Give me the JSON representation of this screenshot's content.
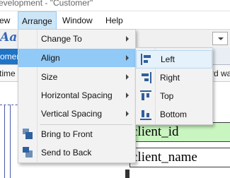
{
  "window": {
    "title": "evelopment - \"Customer\""
  },
  "menubar": {
    "items": [
      {
        "label": "ew"
      },
      {
        "label": "Arrange"
      },
      {
        "label": "Window"
      },
      {
        "label": "Help"
      }
    ]
  },
  "toolbar": {
    "font_preview": "Aa"
  },
  "tabs": {
    "active_label": "omer*"
  },
  "columns": {
    "left": "time",
    "right": "rd wa"
  },
  "canvas": {
    "fields": [
      {
        "label": "client_id",
        "color": "#c9f5c0"
      },
      {
        "label": "client_name",
        "color": "#ffffff"
      }
    ]
  },
  "arrange_menu": {
    "items": [
      {
        "label": "Change To"
      },
      {
        "label": "Align"
      },
      {
        "label": "Size"
      },
      {
        "label": "Horizontal Spacing"
      },
      {
        "label": "Vertical Spacing"
      },
      {
        "label": "Bring to Front",
        "icon": "bring-to-front-icon"
      },
      {
        "label": "Send to Back",
        "icon": "send-to-back-icon"
      }
    ]
  },
  "align_submenu": {
    "items": [
      {
        "label": "Left",
        "icon": "align-left-icon"
      },
      {
        "label": "Right",
        "icon": "align-right-icon"
      },
      {
        "label": "Top",
        "icon": "align-top-icon"
      },
      {
        "label": "Bottom",
        "icon": "align-bottom-icon"
      }
    ]
  },
  "colors": {
    "accent": "#1f74c6",
    "menu_highlight": "#91c9f7",
    "icon_blue": "#2f5f9e",
    "field_green": "#c9f5c0"
  }
}
